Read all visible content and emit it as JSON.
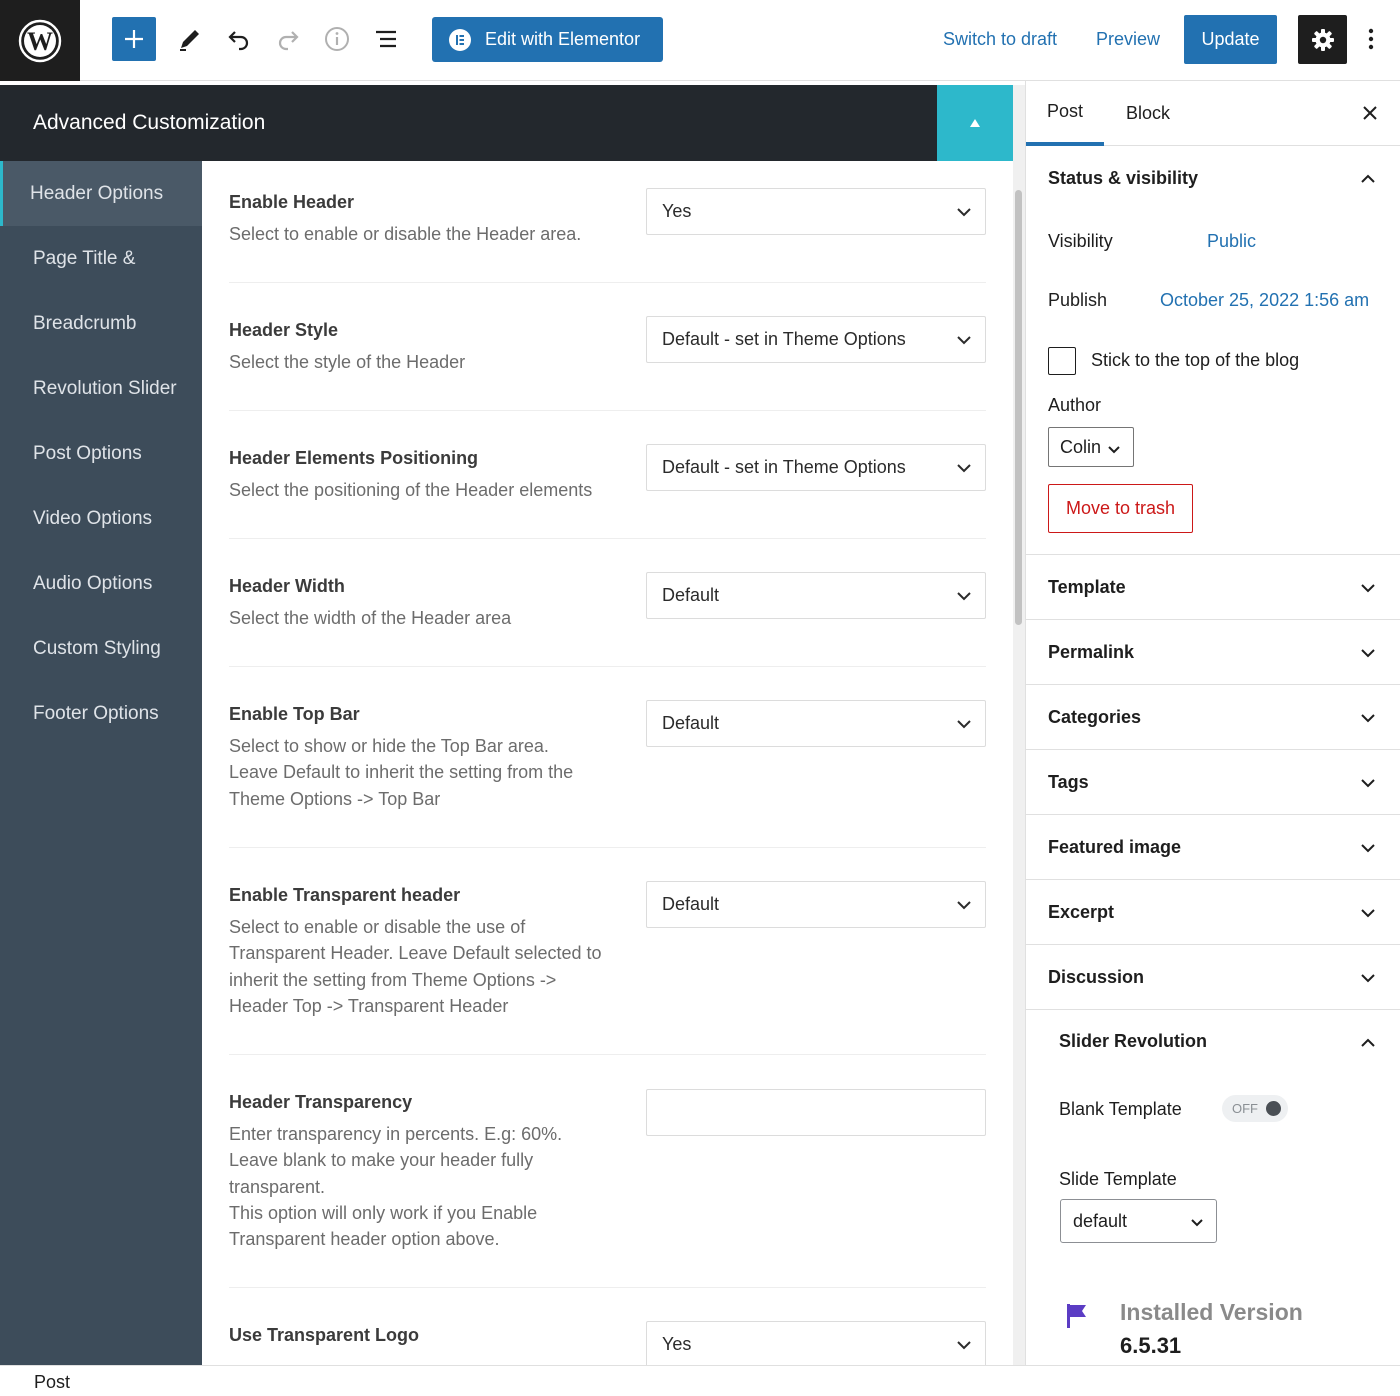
{
  "toolbar": {
    "add_icon": "plus-icon",
    "tools_icon": "pencil-icon",
    "undo_icon": "undo-icon",
    "redo_icon": "redo-icon",
    "details_icon": "info-icon",
    "list_view_icon": "list-view-icon",
    "elementor_label": "Edit with Elementor",
    "switch_to_draft": "Switch to draft",
    "preview": "Preview",
    "update": "Update",
    "settings_icon": "gear-icon",
    "more_icon": "vertical-ellipsis-icon",
    "accent": "#2271b1"
  },
  "metabox": {
    "title": "Advanced Customization",
    "accent": "#2db8cb",
    "nav": [
      {
        "label": "Header Options",
        "active": true
      },
      {
        "label": "Page Title &"
      },
      {
        "label": "Breadcrumb"
      },
      {
        "label": "Revolution Slider"
      },
      {
        "label": "Post Options"
      },
      {
        "label": "Video Options"
      },
      {
        "label": "Audio Options"
      },
      {
        "label": "Custom Styling"
      },
      {
        "label": "Footer Options"
      }
    ],
    "options": [
      {
        "title": "Enable Header",
        "desc": "Select to enable or disable the Header area.",
        "value": "Yes"
      },
      {
        "title": "Header Style",
        "desc": "Select the style of the Header",
        "value": "Default - set in Theme Options"
      },
      {
        "title": "Header Elements Positioning",
        "desc": "Select the positioning of the Header elements",
        "value": "Default - set in Theme Options"
      },
      {
        "title": "Header Width",
        "desc": "Select the width of the Header area",
        "value": "Default"
      },
      {
        "title": "Enable Top Bar",
        "desc": "Select to show or hide the Top Bar area. Leave Default to inherit the setting from the Theme Options -> Top Bar",
        "value": "Default"
      },
      {
        "title": "Enable Transparent header",
        "desc": "Select to enable or disable the use of Transparent Header. Leave Default selected to inherit the setting from Theme Options -> Header Top -> Transparent Header",
        "value": "Default"
      },
      {
        "title": "Header Transparency",
        "desc_lines": [
          "Enter transparency in percents. E.g: 60%. Leave blank to make your header fully transparent.",
          "This option will only work if you Enable Transparent header option above."
        ],
        "value": ""
      },
      {
        "title": "Use Transparent Logo",
        "value": "Yes"
      }
    ]
  },
  "sidebar": {
    "tabs": [
      "Post",
      "Block"
    ],
    "active_tab": "Post",
    "close_icon": "close-icon",
    "status": {
      "heading": "Status & visibility",
      "visibility_label": "Visibility",
      "visibility_value": "Public",
      "publish_label": "Publish",
      "publish_value": "October 25, 2022 1:56 am",
      "sticky_label": "Stick to the top of the blog",
      "sticky_checked": false,
      "author_label": "Author",
      "author_value": "Colin",
      "trash": "Move to trash"
    },
    "panels": [
      "Template",
      "Permalink",
      "Categories",
      "Tags",
      "Featured image",
      "Excerpt",
      "Discussion"
    ],
    "slider": {
      "heading": "Slider Revolution",
      "blank_template_label": "Blank Template",
      "blank_template_toggle": "OFF",
      "slide_template_label": "Slide Template",
      "slide_template_value": "default",
      "installed_label": "Installed Version",
      "installed_version": "6.5.31",
      "flag_color": "#5b3cc4"
    }
  },
  "footer": {
    "breadcrumb": "Post"
  }
}
